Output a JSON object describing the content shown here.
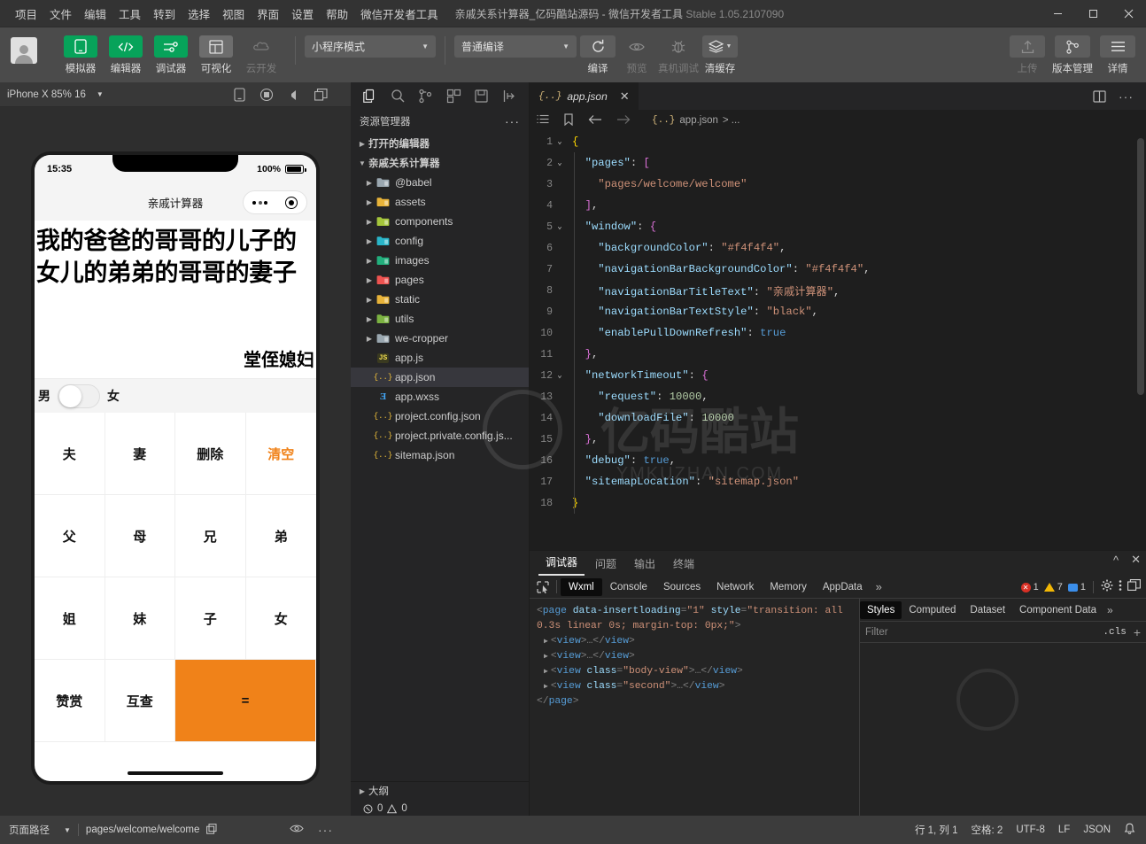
{
  "titlebar": {
    "menus": [
      "项目",
      "文件",
      "编辑",
      "工具",
      "转到",
      "选择",
      "视图",
      "界面",
      "设置",
      "帮助",
      "微信开发者工具"
    ],
    "document_title": "亲戚关系计算器_亿码酷站源码 - 微信开发者工具",
    "version": "Stable 1.05.2107090",
    "minimize": "—",
    "maximize": "▢",
    "close": "✕"
  },
  "toolbar": {
    "mode_select": "小程序模式",
    "compile_select": "普通编译",
    "left_buttons": [
      {
        "label": "模拟器",
        "icon": "phone-icon",
        "style": "green"
      },
      {
        "label": "编辑器",
        "icon": "code-icon",
        "style": "green"
      },
      {
        "label": "调试器",
        "icon": "sliders-icon",
        "style": "green"
      },
      {
        "label": "可视化",
        "icon": "layout-icon",
        "style": "grey"
      },
      {
        "label": "云开发",
        "icon": "cloud-icon",
        "style": "disabled"
      }
    ],
    "action_buttons": [
      {
        "label": "编译",
        "icon": "refresh-icon",
        "disabled": false
      },
      {
        "label": "预览",
        "icon": "eye-icon",
        "disabled": true
      },
      {
        "label": "真机调试",
        "icon": "bug-icon",
        "disabled": true
      },
      {
        "label": "清缓存",
        "icon": "layers-icon",
        "disabled": false
      }
    ],
    "right_buttons": [
      {
        "label": "上传",
        "icon": "upload-icon",
        "disabled": true
      },
      {
        "label": "版本管理",
        "icon": "branch-icon",
        "disabled": false
      },
      {
        "label": "详情",
        "icon": "menu-icon",
        "disabled": false
      }
    ]
  },
  "simulator": {
    "device": "iPhone X 85% 16",
    "header_icons": [
      "phone-rotate-icon",
      "record-icon",
      "volume-icon",
      "window-icon"
    ],
    "phone": {
      "status_time": "15:35",
      "battery_percent": "100%",
      "nav_title": "亲戚计算器",
      "expression": "我的爸爸的哥哥的儿子的女儿的弟弟的哥哥的妻子",
      "result": "堂侄媳妇",
      "gender_left": "男",
      "gender_right": "女",
      "keys": [
        {
          "label": "夫",
          "style": "normal"
        },
        {
          "label": "妻",
          "style": "normal"
        },
        {
          "label": "删除",
          "style": "normal"
        },
        {
          "label": "清空",
          "style": "accent-text"
        },
        {
          "label": "父",
          "style": "normal"
        },
        {
          "label": "母",
          "style": "normal"
        },
        {
          "label": "兄",
          "style": "normal"
        },
        {
          "label": "弟",
          "style": "normal"
        },
        {
          "label": "姐",
          "style": "normal"
        },
        {
          "label": "妹",
          "style": "normal"
        },
        {
          "label": "子",
          "style": "normal"
        },
        {
          "label": "女",
          "style": "normal"
        },
        {
          "label": "赞赏",
          "style": "normal"
        },
        {
          "label": "互查",
          "style": "normal"
        },
        {
          "label": "=",
          "style": "accent-bg"
        }
      ]
    },
    "status": {
      "page_path_label": "页面路径",
      "page_path": "pages/welcome/welcome",
      "copy_icon": "copy-icon",
      "eye_icon": "eye-icon",
      "more_icon": "more-icon"
    }
  },
  "explorer": {
    "icons": [
      "files-icon",
      "search-icon",
      "source-control-icon",
      "extensions-icon",
      "save-icon",
      "collapse-icon"
    ],
    "title": "资源管理器",
    "more": "···",
    "sections": [
      {
        "label": "打开的编辑器",
        "expanded": false
      },
      {
        "label": "亲戚关系计算器",
        "expanded": true
      }
    ],
    "files": [
      {
        "name": "@babel",
        "type": "folder",
        "color": "#9aa7b0"
      },
      {
        "name": "assets",
        "type": "folder",
        "color": "#e8b339"
      },
      {
        "name": "components",
        "type": "folder",
        "color": "#a5c63b"
      },
      {
        "name": "config",
        "type": "folder",
        "color": "#29b6c9"
      },
      {
        "name": "images",
        "type": "folder",
        "color": "#22b07d"
      },
      {
        "name": "pages",
        "type": "folder",
        "color": "#ef5350"
      },
      {
        "name": "static",
        "type": "folder",
        "color": "#e8b339"
      },
      {
        "name": "utils",
        "type": "folder",
        "color": "#7cb342"
      },
      {
        "name": "we-cropper",
        "type": "folder",
        "color": "#9aa7b0"
      },
      {
        "name": "app.js",
        "type": "js",
        "color": "#f0db4f"
      },
      {
        "name": "app.json",
        "type": "json",
        "color": "#f0c03a",
        "selected": true
      },
      {
        "name": "app.wxss",
        "type": "wxss",
        "color": "#42a5f5"
      },
      {
        "name": "project.config.json",
        "type": "json",
        "color": "#f0c03a"
      },
      {
        "name": "project.private.config.js...",
        "type": "json",
        "color": "#f0c03a"
      },
      {
        "name": "sitemap.json",
        "type": "json",
        "color": "#f0c03a"
      }
    ],
    "outline": {
      "label": "大纲",
      "errors": "0",
      "warnings": "0"
    }
  },
  "editor": {
    "tab_name": "app.json",
    "tab_close": "✕",
    "breadcrumb_file": "app.json",
    "breadcrumb_tail": "> ...",
    "split_icon": "split-editor-icon",
    "more_icon": "more-icon",
    "lines": [
      {
        "n": "1",
        "fold": "v",
        "indent": 0,
        "tokens": [
          {
            "t": "{",
            "c": "k-br1"
          }
        ]
      },
      {
        "n": "2",
        "fold": "v",
        "indent": 1,
        "tokens": [
          {
            "t": "\"pages\"",
            "c": "k-key"
          },
          {
            "t": ": ",
            "c": "k-pun"
          },
          {
            "t": "[",
            "c": "k-br2"
          }
        ]
      },
      {
        "n": "3",
        "fold": "",
        "indent": 2,
        "tokens": [
          {
            "t": "\"pages/welcome/welcome\"",
            "c": "k-str"
          }
        ]
      },
      {
        "n": "4",
        "fold": "",
        "indent": 1,
        "tokens": [
          {
            "t": "]",
            "c": "k-br2"
          },
          {
            "t": ",",
            "c": "k-pun"
          }
        ]
      },
      {
        "n": "5",
        "fold": "v",
        "indent": 1,
        "tokens": [
          {
            "t": "\"window\"",
            "c": "k-key"
          },
          {
            "t": ": ",
            "c": "k-pun"
          },
          {
            "t": "{",
            "c": "k-br2"
          }
        ]
      },
      {
        "n": "6",
        "fold": "",
        "indent": 2,
        "tokens": [
          {
            "t": "\"backgroundColor\"",
            "c": "k-key"
          },
          {
            "t": ": ",
            "c": "k-pun"
          },
          {
            "t": "\"#f4f4f4\"",
            "c": "k-str"
          },
          {
            "t": ",",
            "c": "k-pun"
          }
        ]
      },
      {
        "n": "7",
        "fold": "",
        "indent": 2,
        "tokens": [
          {
            "t": "\"navigationBarBackgroundColor\"",
            "c": "k-key"
          },
          {
            "t": ": ",
            "c": "k-pun"
          },
          {
            "t": "\"#f4f4f4\"",
            "c": "k-str"
          },
          {
            "t": ",",
            "c": "k-pun"
          }
        ]
      },
      {
        "n": "8",
        "fold": "",
        "indent": 2,
        "tokens": [
          {
            "t": "\"navigationBarTitleText\"",
            "c": "k-key"
          },
          {
            "t": ": ",
            "c": "k-pun"
          },
          {
            "t": "\"亲戚计算器\"",
            "c": "k-str"
          },
          {
            "t": ",",
            "c": "k-pun"
          }
        ]
      },
      {
        "n": "9",
        "fold": "",
        "indent": 2,
        "tokens": [
          {
            "t": "\"navigationBarTextStyle\"",
            "c": "k-key"
          },
          {
            "t": ": ",
            "c": "k-pun"
          },
          {
            "t": "\"black\"",
            "c": "k-str"
          },
          {
            "t": ",",
            "c": "k-pun"
          }
        ]
      },
      {
        "n": "10",
        "fold": "",
        "indent": 2,
        "tokens": [
          {
            "t": "\"enablePullDownRefresh\"",
            "c": "k-key"
          },
          {
            "t": ": ",
            "c": "k-pun"
          },
          {
            "t": "true",
            "c": "k-bool"
          }
        ]
      },
      {
        "n": "11",
        "fold": "",
        "indent": 1,
        "tokens": [
          {
            "t": "}",
            "c": "k-br2"
          },
          {
            "t": ",",
            "c": "k-pun"
          }
        ]
      },
      {
        "n": "12",
        "fold": "v",
        "indent": 1,
        "tokens": [
          {
            "t": "\"networkTimeout\"",
            "c": "k-key"
          },
          {
            "t": ": ",
            "c": "k-pun"
          },
          {
            "t": "{",
            "c": "k-br2"
          }
        ]
      },
      {
        "n": "13",
        "fold": "",
        "indent": 2,
        "tokens": [
          {
            "t": "\"request\"",
            "c": "k-key"
          },
          {
            "t": ": ",
            "c": "k-pun"
          },
          {
            "t": "10000",
            "c": "k-num"
          },
          {
            "t": ",",
            "c": "k-pun"
          }
        ]
      },
      {
        "n": "14",
        "fold": "",
        "indent": 2,
        "tokens": [
          {
            "t": "\"downloadFile\"",
            "c": "k-key"
          },
          {
            "t": ": ",
            "c": "k-pun"
          },
          {
            "t": "10000",
            "c": "k-num"
          }
        ]
      },
      {
        "n": "15",
        "fold": "",
        "indent": 1,
        "tokens": [
          {
            "t": "}",
            "c": "k-br2"
          },
          {
            "t": ",",
            "c": "k-pun"
          }
        ]
      },
      {
        "n": "16",
        "fold": "",
        "indent": 1,
        "tokens": [
          {
            "t": "\"debug\"",
            "c": "k-key"
          },
          {
            "t": ": ",
            "c": "k-pun"
          },
          {
            "t": "true",
            "c": "k-bool"
          },
          {
            "t": ",",
            "c": "k-pun"
          }
        ]
      },
      {
        "n": "17",
        "fold": "",
        "indent": 1,
        "tokens": [
          {
            "t": "\"sitemapLocation\"",
            "c": "k-key"
          },
          {
            "t": ": ",
            "c": "k-pun"
          },
          {
            "t": "\"sitemap.json\"",
            "c": "k-str"
          }
        ]
      },
      {
        "n": "18",
        "fold": "",
        "indent": 0,
        "tokens": [
          {
            "t": "}",
            "c": "k-br1"
          }
        ]
      }
    ]
  },
  "debugger": {
    "panel_tabs": [
      {
        "label": "调试器",
        "active": true
      },
      {
        "label": "问题",
        "active": false
      },
      {
        "label": "输出",
        "active": false
      },
      {
        "label": "终端",
        "active": false
      }
    ],
    "collapse_icon": "^",
    "close_icon": "✕",
    "devtools_tabs": [
      {
        "label": "Wxml",
        "active": true
      },
      {
        "label": "Console",
        "active": false
      },
      {
        "label": "Sources",
        "active": false
      },
      {
        "label": "Network",
        "active": false
      },
      {
        "label": "Memory",
        "active": false
      },
      {
        "label": "AppData",
        "active": false
      }
    ],
    "devtools_more": "»",
    "counters": {
      "errors": "1",
      "warnings": "7",
      "info": "1"
    },
    "gear_icon": "gear-icon",
    "kebab_icon": "kebab-icon",
    "dock_icon": "dock-icon",
    "wxml": [
      {
        "indent": 0,
        "tri": false,
        "html": "<span class=\"w-pun\">&lt;</span><span class=\"w-tag\">page</span> <span class=\"w-attr\">data-insertloading</span><span class=\"w-pun\">=</span><span class=\"w-val\">\"1\"</span> <span class=\"w-attr\">style</span><span class=\"w-pun\">=</span><span class=\"w-val\">\"transition: all 0.3s linear 0s; margin-top: 0px;\"</span><span class=\"w-pun\">&gt;</span>"
      },
      {
        "indent": 1,
        "tri": true,
        "html": "<span class=\"w-pun\">&lt;</span><span class=\"w-tag\">view</span><span class=\"w-pun\">&gt;</span><span class=\"w-pun\">…</span><span class=\"w-pun\">&lt;/</span><span class=\"w-tag\">view</span><span class=\"w-pun\">&gt;</span>"
      },
      {
        "indent": 1,
        "tri": true,
        "html": "<span class=\"w-pun\">&lt;</span><span class=\"w-tag\">view</span><span class=\"w-pun\">&gt;</span><span class=\"w-pun\">…</span><span class=\"w-pun\">&lt;/</span><span class=\"w-tag\">view</span><span class=\"w-pun\">&gt;</span>"
      },
      {
        "indent": 1,
        "tri": true,
        "html": "<span class=\"w-pun\">&lt;</span><span class=\"w-tag\">view</span> <span class=\"w-attr\">class</span><span class=\"w-pun\">=</span><span class=\"w-val\">\"body-view\"</span><span class=\"w-pun\">&gt;</span><span class=\"w-pun\">…</span><span class=\"w-pun\">&lt;/</span><span class=\"w-tag\">view</span><span class=\"w-pun\">&gt;</span>"
      },
      {
        "indent": 1,
        "tri": true,
        "html": "<span class=\"w-pun\">&lt;</span><span class=\"w-tag\">view</span> <span class=\"w-attr\">class</span><span class=\"w-pun\">=</span><span class=\"w-val\">\"second\"</span><span class=\"w-pun\">&gt;</span><span class=\"w-pun\">…</span><span class=\"w-pun\">&lt;/</span><span class=\"w-tag\">view</span><span class=\"w-pun\">&gt;</span>"
      },
      {
        "indent": 0,
        "tri": false,
        "html": "<span class=\"w-pun\">&lt;/</span><span class=\"w-tag\">page</span><span class=\"w-pun\">&gt;</span>"
      }
    ],
    "styles_tabs": [
      {
        "label": "Styles",
        "active": true
      },
      {
        "label": "Computed",
        "active": false
      },
      {
        "label": "Dataset",
        "active": false
      },
      {
        "label": "Component Data",
        "active": false
      }
    ],
    "styles_more": "»",
    "filter_placeholder": "Filter",
    "cls_label": ".cls",
    "plus": "+"
  },
  "statusbar": {
    "line_col": "行 1, 列 1",
    "spaces": "空格: 2",
    "encoding": "UTF-8",
    "eol": "LF",
    "language": "JSON",
    "bell_icon": "bell-icon"
  },
  "colors": {
    "accent_orange": "#f08219",
    "green": "#07a35a",
    "titlebar_bg": "#333333",
    "toolbar_bg": "#4b4b4b",
    "editor_bg": "#1e1e1e",
    "explorer_bg": "#252526",
    "selected_row": "#37373d"
  },
  "watermark": {
    "text": "亿码酷站",
    "sub": "YMKUZHAN.COM"
  }
}
